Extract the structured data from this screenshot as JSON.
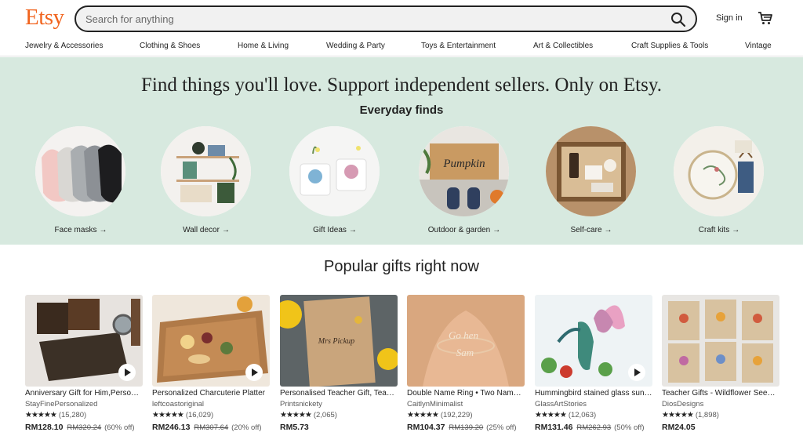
{
  "header": {
    "logo": "Etsy",
    "search_placeholder": "Search for anything",
    "signin": "Sign in"
  },
  "categories": [
    "Jewelry & Accessories",
    "Clothing & Shoes",
    "Home & Living",
    "Wedding & Party",
    "Toys & Entertainment",
    "Art & Collectibles",
    "Craft Supplies & Tools",
    "Vintage"
  ],
  "hero": {
    "title": "Find things you'll love. Support independent sellers. Only on Etsy.",
    "subtitle": "Everyday finds",
    "finds": [
      {
        "label": "Face masks",
        "arrow": "→"
      },
      {
        "label": "Wall decor",
        "arrow": "→"
      },
      {
        "label": "Gift Ideas",
        "arrow": "→"
      },
      {
        "label": "Outdoor & garden",
        "arrow": "→"
      },
      {
        "label": "Self-care",
        "arrow": "→"
      },
      {
        "label": "Craft kits",
        "arrow": "→"
      }
    ]
  },
  "popular": {
    "title": "Popular gifts right now",
    "items": [
      {
        "title": "Anniversary Gift for Him,Personalized Wallet",
        "shop": "StayFinePersonalized",
        "stars": "★★★★★",
        "count": "(15,280)",
        "price": "RM128.10",
        "original": "RM320.24",
        "discount": "(60% off)",
        "video": true
      },
      {
        "title": "Personalized Charcuterie Platter",
        "shop": "leftcoastoriginal",
        "stars": "★★★★★",
        "count": "(16,029)",
        "price": "RM246.13",
        "original": "RM307.64",
        "discount": "(20% off)",
        "video": true
      },
      {
        "title": "Personalised Teacher Gift, Teacher Card",
        "shop": "Printsnickety",
        "stars": "★★★★★",
        "count": "(2,065)",
        "price": "RM5.73",
        "original": "",
        "discount": "",
        "video": false
      },
      {
        "title": "Double Name Ring • Two Name Ring",
        "shop": "CaitlynMinimalist",
        "stars": "★★★★★",
        "count": "(192,229)",
        "price": "RM104.37",
        "original": "RM139.20",
        "discount": "(25% off)",
        "video": false
      },
      {
        "title": "Hummingbird stained glass suncatcher",
        "shop": "GlassArtStories",
        "stars": "★★★★★",
        "count": "(12,063)",
        "price": "RM131.46",
        "original": "RM262.93",
        "discount": "(50% off)",
        "video": true
      },
      {
        "title": "Teacher Gifts - Wildflower Seed Cards",
        "shop": "DiosDesigns",
        "stars": "★★★★★",
        "count": "(1,898)",
        "price": "RM24.05",
        "original": "",
        "discount": "",
        "video": false
      }
    ]
  },
  "icons": {
    "search": "search-icon",
    "cart": "cart-icon",
    "play": "play-icon"
  },
  "colors": {
    "brand": "#f1641e",
    "hero_bg": "#d7e9df"
  }
}
